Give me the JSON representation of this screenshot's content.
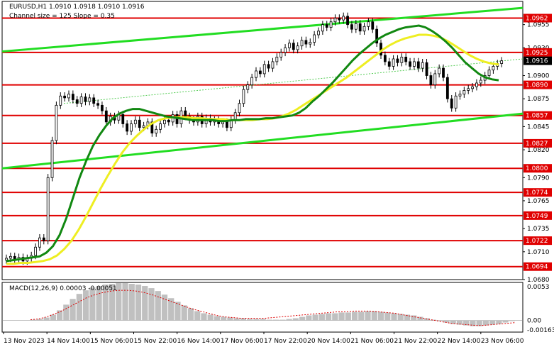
{
  "header": {
    "line1": "EURUSD,H1  1.0910 1.0918 1.0910 1.0916",
    "line2": "Channel size = 125 Slope = 0.35"
  },
  "indicator_label": "MACD(12,26,9) 0.00003 -0.00051",
  "colors": {
    "level": "#e00000",
    "channel": "#22dd22",
    "ma_fast": "#118811",
    "ma_slow": "#eeee22",
    "candle": "#000000",
    "envelope": "#aa33aa",
    "macd_hist": "#c0c0c0",
    "macd_signal": "#dd0000",
    "dotted_mid": "#55cc55"
  },
  "chart_data": [
    {
      "type": "candlestick",
      "symbol": "EURUSD",
      "timeframe": "H1",
      "ylim": [
        1.068,
        1.098
      ],
      "y_ticks": [
        "1.0955",
        "1.0930",
        "1.0900",
        "1.0875",
        "1.0845",
        "1.0820",
        "1.0790",
        "1.0765",
        "1.0735",
        "1.0710",
        "1.0680"
      ],
      "x_labels": [
        "13 Nov 2023",
        "14 Nov 14:00",
        "15 Nov 06:00",
        "15 Nov 22:00",
        "16 Nov 14:00",
        "17 Nov 06:00",
        "17 Nov 22:00",
        "20 Nov 14:00",
        "21 Nov 06:00",
        "21 Nov 22:00",
        "22 Nov 14:00",
        "23 Nov 06:00"
      ],
      "levels": [
        "1.0962",
        "1.0925",
        "1.0890",
        "1.0857",
        "1.0827",
        "1.0800",
        "1.0774",
        "1.0749",
        "1.0722",
        "1.0694"
      ],
      "last_price": "1.0916",
      "closes": [
        1.0703,
        1.0705,
        1.0702,
        1.0704,
        1.07,
        1.0703,
        1.0706,
        1.0715,
        1.0725,
        1.0722,
        1.079,
        1.083,
        1.0868,
        1.0878,
        1.0876,
        1.088,
        1.0874,
        1.087,
        1.0877,
        1.0872,
        1.0876,
        1.087,
        1.0868,
        1.0862,
        1.085,
        1.0856,
        1.0852,
        1.0858,
        1.0848,
        1.084,
        1.0848,
        1.0852,
        1.0844,
        1.0846,
        1.085,
        1.0838,
        1.0842,
        1.0848,
        1.0852,
        1.085,
        1.0858,
        1.0848,
        1.0862,
        1.0856,
        1.0852,
        1.085,
        1.0856,
        1.0848,
        1.0854,
        1.085,
        1.0852,
        1.0848,
        1.085,
        1.0844,
        1.0852,
        1.086,
        1.087,
        1.0885,
        1.089,
        1.0898,
        1.0905,
        1.0902,
        1.0912,
        1.0908,
        1.0915,
        1.092,
        1.0925,
        1.093,
        1.0935,
        1.0928,
        1.0932,
        1.0938,
        1.0934,
        1.0936,
        1.0944,
        1.0948,
        1.0955,
        1.0952,
        1.0958,
        1.0962,
        1.096,
        1.0964,
        1.0955,
        1.095,
        1.0956,
        1.0948,
        1.0953,
        1.0958,
        1.095,
        1.0935,
        1.0922,
        1.0915,
        1.091,
        1.0918,
        1.0914,
        1.092,
        1.0915,
        1.091,
        1.0915,
        1.0908,
        1.0914,
        1.09,
        1.089,
        1.0902,
        1.0908,
        1.0898,
        1.0875,
        1.0865,
        1.0878,
        1.088,
        1.0884,
        1.0886,
        1.0888,
        1.0892,
        1.0895,
        1.09,
        1.0906,
        1.091,
        1.0913,
        1.0916
      ],
      "moving_averages": [
        {
          "period": "fast",
          "values": [
            1.07,
            1.0701,
            1.0702,
            1.0703,
            1.0704,
            1.0705,
            1.0709,
            1.0716,
            1.0728,
            1.0746,
            1.0768,
            1.079,
            1.0808,
            1.0824,
            1.0836,
            1.0846,
            1.0854,
            1.0859,
            1.0862,
            1.0864,
            1.0864,
            1.0862,
            1.086,
            1.0858,
            1.0856,
            1.0855,
            1.0854,
            1.0853,
            1.0852,
            1.0852,
            1.0852,
            1.0852,
            1.0851,
            1.0851,
            1.0852,
            1.0852,
            1.0853,
            1.0853,
            1.0853,
            1.0854,
            1.0854,
            1.0855,
            1.0856,
            1.0857,
            1.086,
            1.0865,
            1.0872,
            1.0878,
            1.0885,
            1.0892,
            1.09,
            1.0908,
            1.0916,
            1.0923,
            1.0929,
            1.0935,
            1.094,
            1.0944,
            1.0947,
            1.095,
            1.0952,
            1.0953,
            1.0954,
            1.0952,
            1.0948,
            1.0943,
            1.0937,
            1.093,
            1.0922,
            1.0914,
            1.0908,
            1.0902,
            1.0898,
            1.0896,
            1.0895
          ]
        },
        {
          "period": "slow",
          "values": [
            1.0697,
            1.0697,
            1.0698,
            1.0698,
            1.0699,
            1.07,
            1.0702,
            1.0706,
            1.0713,
            1.0722,
            1.0734,
            1.0748,
            1.0763,
            1.0778,
            1.0792,
            1.0805,
            1.0817,
            1.0827,
            1.0835,
            1.0842,
            1.0848,
            1.0852,
            1.0854,
            1.0855,
            1.0855,
            1.0855,
            1.0854,
            1.0854,
            1.0853,
            1.0853,
            1.0853,
            1.0852,
            1.0852,
            1.0852,
            1.0852,
            1.0853,
            1.0853,
            1.0854,
            1.0856,
            1.0859,
            1.0863,
            1.0868,
            1.0873,
            1.0878,
            1.0883,
            1.0888,
            1.0893,
            1.0898,
            1.0904,
            1.091,
            1.0916,
            1.0922,
            1.0928,
            1.0933,
            1.0937,
            1.094,
            1.0942,
            1.0944,
            1.0944,
            1.0943,
            1.0941,
            1.0937,
            1.0932,
            1.0927,
            1.0922,
            1.0918,
            1.0915,
            1.0913,
            1.0912
          ]
        }
      ]
    },
    {
      "type": "bar",
      "name": "MACD(12,26,9)",
      "y_ticks": [
        "0.0053",
        "0.00",
        "-0.00163"
      ],
      "ylim": [
        -0.00163,
        0.0053
      ],
      "histogram": [
        0.0001,
        0.0002,
        0.0004,
        0.0008,
        0.0014,
        0.0022,
        0.003,
        0.0037,
        0.0042,
        0.0046,
        0.0048,
        0.005,
        0.0051,
        0.0052,
        0.0052,
        0.0051,
        0.005,
        0.0048,
        0.0045,
        0.0041,
        0.0036,
        0.0031,
        0.0026,
        0.0021,
        0.0017,
        0.0013,
        0.001,
        0.0008,
        0.0006,
        0.0005,
        0.0004,
        0.0003,
        0.0003,
        0.0002,
        0.0002,
        0.0002,
        0.0001,
        0.0001,
        0.0001,
        0.0002,
        0.0003,
        0.0005,
        0.0007,
        0.0008,
        0.0009,
        0.001,
        0.001,
        0.0011,
        0.0011,
        0.0012,
        0.0012,
        0.0013,
        0.0013,
        0.0012,
        0.0011,
        0.001,
        0.0009,
        0.0008,
        0.0007,
        0.0005,
        0.0003,
        0.0001,
        -0.0001,
        -0.0003,
        -0.0005,
        -0.0006,
        -0.0007,
        -0.0008,
        -0.0008,
        -0.0007,
        -0.0006,
        -0.0005,
        -0.0003,
        -0.0001
      ],
      "signal": [
        0.0001,
        0.0002,
        0.0005,
        0.0009,
        0.0014,
        0.002,
        0.0026,
        0.0032,
        0.0036,
        0.0039,
        0.0041,
        0.0042,
        0.0042,
        0.0041,
        0.0039,
        0.0036,
        0.0032,
        0.0028,
        0.0024,
        0.002,
        0.0016,
        0.0013,
        0.001,
        0.0007,
        0.0005,
        0.0004,
        0.0003,
        0.0003,
        0.0003,
        0.0003,
        0.0004,
        0.0005,
        0.0006,
        0.0007,
        0.0008,
        0.0009,
        0.001,
        0.0011,
        0.0012,
        0.0012,
        0.0013,
        0.0013,
        0.0013,
        0.0012,
        0.0011,
        0.001,
        0.0008,
        0.0006,
        0.0004,
        0.0002,
        0.0,
        -0.0002,
        -0.0004,
        -0.0005,
        -0.0006,
        -0.0007,
        -0.0007,
        -0.0006,
        -0.0005,
        -0.0004,
        -0.0003
      ]
    }
  ]
}
